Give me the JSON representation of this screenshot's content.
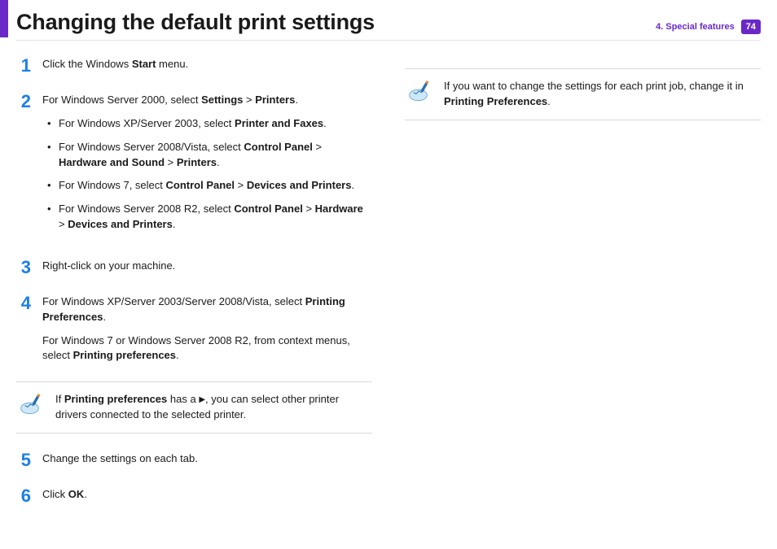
{
  "header": {
    "title": "Changing the default print settings",
    "section_label": "4.   Special features",
    "page_number": "74"
  },
  "steps": {
    "s1": {
      "num": "1",
      "text_pre": "Click the Windows ",
      "b1": "Start",
      "text_post": " menu."
    },
    "s2": {
      "num": "2",
      "lead_pre": "For Windows Server 2000, select ",
      "b1": "Settings",
      "gt1": " > ",
      "b2": "Printers",
      "tail1": ".",
      "li1_pre": "For Windows XP/Server 2003, select ",
      "li1_b": "Printer and Faxes",
      "li1_post": ".",
      "li2_pre": "For Windows Server 2008/Vista, select ",
      "li2_b1": "Control Panel",
      "li2_gt1": " > ",
      "li2_b2": "Hardware and Sound",
      "li2_gt2": " > ",
      "li2_b3": "Printers",
      "li2_post": ".",
      "li3_pre": "For Windows 7, select ",
      "li3_b1": "Control Panel",
      "li3_gt1": " > ",
      "li3_b2": "Devices and Printers",
      "li3_post": ".",
      "li4_pre": "For Windows Server 2008 R2, select ",
      "li4_b1": "Control Panel",
      "li4_gt1": " > ",
      "li4_b2": "Hardware",
      "li4_gt2": " > ",
      "li4_b3": "Devices and Printers",
      "li4_post": "."
    },
    "s3": {
      "num": "3",
      "text": "Right-click on your machine."
    },
    "s4": {
      "num": "4",
      "p1_pre": "For Windows XP/Server 2003/Server 2008/Vista, select ",
      "p1_b": "Printing Preferences",
      "p1_post": ".",
      "p2_pre": "For Windows 7 or Windows Server 2008 R2, from context menus, select ",
      "p2_b": "Printing preferences",
      "p2_post": "."
    },
    "s5": {
      "num": "5",
      "text": "Change the settings on each tab."
    },
    "s6": {
      "num": "6",
      "text_pre": "Click ",
      "b1": "OK",
      "text_post": "."
    }
  },
  "note_left": {
    "pre": "If ",
    "b1": "Printing preferences",
    "mid": " has a ",
    "tri": "▶",
    "post": ", you can select other printer drivers connected to the selected printer."
  },
  "note_right": {
    "pre": "If you want to change the settings for each print job, change it in ",
    "b1": "Printing Preferences",
    "post": "."
  }
}
